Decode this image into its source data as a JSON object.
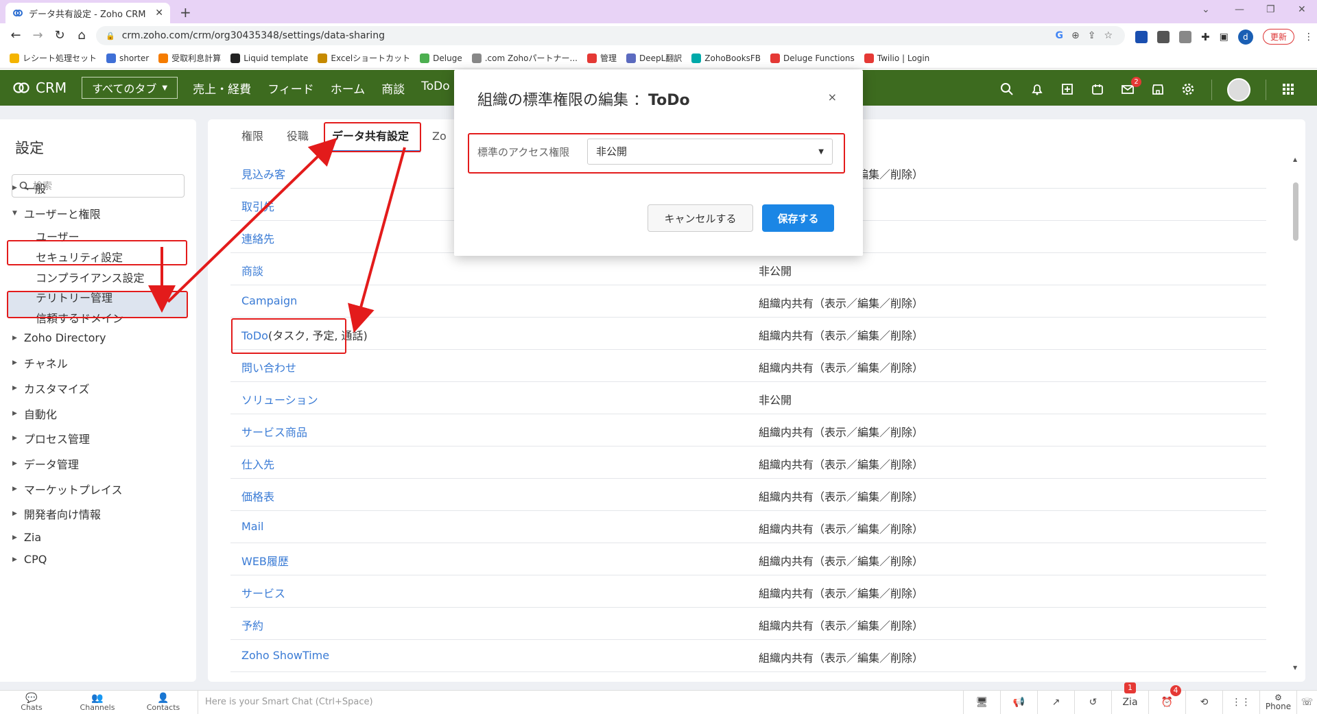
{
  "browser": {
    "tab_title": "データ共有設定 - Zoho CRM",
    "tab_close": "✕",
    "new_tab": "+",
    "url": "crm.zoho.com/crm/org30435348/settings/data-sharing",
    "profile_initial": "d",
    "update_label": "更新",
    "bookmarks": [
      "レシート処理セット",
      "shorter",
      "受取利息計算",
      "Liquid template",
      "Excelショートカット",
      "Deluge",
      ".com Zohoパートナー...",
      "管理",
      "DeepL翻訳",
      "ZohoBooksFB",
      "Deluge Functions",
      "Twilio | Login"
    ]
  },
  "crm_header": {
    "app_name": "CRM",
    "all_tabs_label": "すべてのタブ",
    "nav": [
      "売上・経費",
      "フィード",
      "ホーム",
      "商談",
      "ToDo"
    ],
    "mail_badge": "2"
  },
  "sidebar": {
    "title": "設定",
    "search_placeholder": "検索",
    "sections": [
      {
        "label": "一般"
      },
      {
        "label": "ユーザーと権限",
        "expanded": true,
        "children": [
          "ユーザー",
          "セキュリティ設定",
          "コンプライアンス設定",
          "テリトリー管理",
          "信頼するドメイン"
        ]
      },
      {
        "label": "Zoho Directory"
      },
      {
        "label": "チャネル"
      },
      {
        "label": "カスタマイズ"
      },
      {
        "label": "自動化"
      },
      {
        "label": "プロセス管理"
      },
      {
        "label": "データ管理"
      },
      {
        "label": "マーケットプレイス"
      },
      {
        "label": "開発者向け情報"
      },
      {
        "label": "Zia"
      },
      {
        "label": "CPQ"
      }
    ]
  },
  "subtabs": [
    "権限",
    "役職",
    "データ共有設定",
    "Zo"
  ],
  "sharing_rows": [
    {
      "module": "見込み客",
      "access": "組織内共有（表示／編集／削除）"
    },
    {
      "module": "取引先",
      "access": ""
    },
    {
      "module": "連絡先",
      "access": ""
    },
    {
      "module": "商談",
      "access": "非公開"
    },
    {
      "module": "Campaign",
      "access": "組織内共有（表示／編集／削除）"
    },
    {
      "module": "ToDo",
      "module_suffix": "(タスク, 予定, 通話)",
      "access": "組織内共有（表示／編集／削除）"
    },
    {
      "module": "問い合わせ",
      "access": "組織内共有（表示／編集／削除）"
    },
    {
      "module": "ソリューション",
      "access": "非公開"
    },
    {
      "module": "サービス商品",
      "access": "組織内共有（表示／編集／削除）"
    },
    {
      "module": "仕入先",
      "access": "組織内共有（表示／編集／削除）"
    },
    {
      "module": "価格表",
      "access": "組織内共有（表示／編集／削除）"
    },
    {
      "module": "Mail",
      "access": "組織内共有（表示／編集／削除）"
    },
    {
      "module": "WEB履歴",
      "access": "組織内共有（表示／編集／削除）"
    },
    {
      "module": "サービス",
      "access": "組織内共有（表示／編集／削除）"
    },
    {
      "module": "予約",
      "access": "組織内共有（表示／編集／削除）"
    },
    {
      "module": "Zoho ShowTime",
      "access": "組織内共有（表示／編集／削除）"
    }
  ],
  "modal": {
    "title_prefix": "組織の標準権限の編集 ：",
    "title_module": "ToDo",
    "close": "×",
    "field_label": "標準のアクセス権限",
    "selected_value": "非公開",
    "cancel_label": "キャンセルする",
    "save_label": "保存する"
  },
  "bottom_bar": {
    "left_items": [
      "Chats",
      "Channels",
      "Contacts"
    ],
    "smart_chat_placeholder": "Here is your Smart Chat (Ctrl+Space)",
    "phone_label": "Phone",
    "badge_1": "1",
    "badge_4": "4"
  },
  "colors": {
    "crm_header": "#3d6b1f",
    "accent": "#1b86e5",
    "link": "#3a7bd5",
    "annotation": "#e31b1b"
  }
}
